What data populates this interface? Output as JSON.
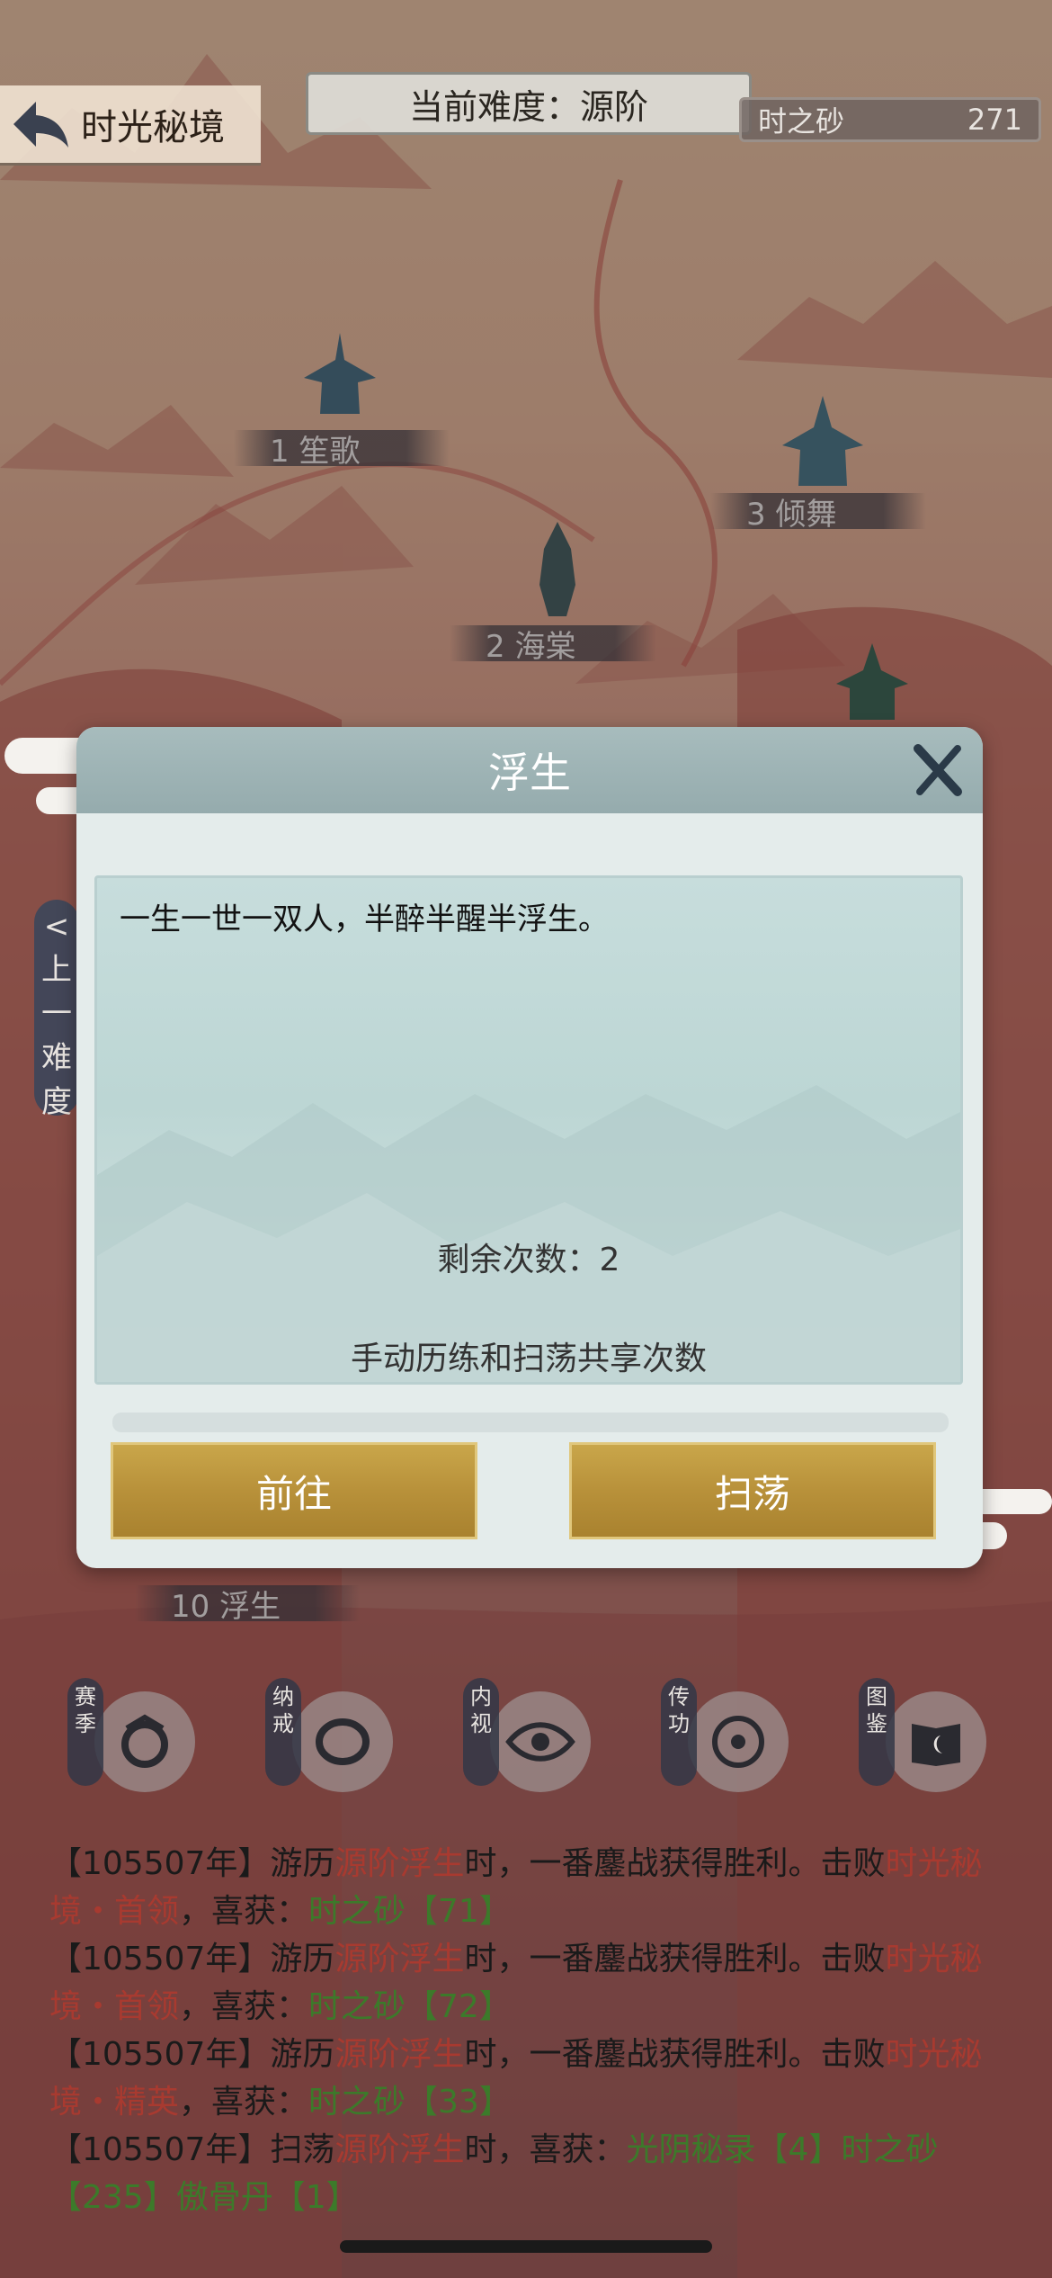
{
  "header": {
    "back_title": "时光秘境",
    "difficulty": "当前难度：源阶",
    "currency_name": "时之砂",
    "currency_value": "271"
  },
  "stages": [
    {
      "label": "1 笙歌"
    },
    {
      "label": "2 海棠"
    },
    {
      "label": "3 倾舞"
    },
    {
      "label": "10 浮生"
    }
  ],
  "side_tab": {
    "chars": [
      "<",
      "上",
      "一",
      "难",
      "度"
    ]
  },
  "modal": {
    "title": "浮生",
    "description": "一生一世一双人，半醉半醒半浮生。",
    "remaining": "剩余次数：2",
    "shared_note": "手动历练和扫荡共享次数",
    "go_label": "前往",
    "sweep_label": "扫荡"
  },
  "icons": [
    {
      "tag": [
        "赛",
        "季"
      ],
      "name": "season-icon"
    },
    {
      "tag": [
        "纳",
        "戒"
      ],
      "name": "ring-icon"
    },
    {
      "tag": [
        "内",
        "视"
      ],
      "name": "eye-icon"
    },
    {
      "tag": [
        "传",
        "功"
      ],
      "name": "transfer-icon"
    },
    {
      "tag": [
        "图",
        "鉴"
      ],
      "name": "book-icon"
    }
  ],
  "log": [
    [
      {
        "t": "【105507年】游历",
        "c": ""
      },
      {
        "t": "源阶浮生",
        "c": "r"
      },
      {
        "t": "时，一番鏖战获得胜利。击败",
        "c": ""
      },
      {
        "t": "时光秘境・首领",
        "c": "r"
      },
      {
        "t": "，喜获：",
        "c": ""
      },
      {
        "t": "时之砂【71】",
        "c": "g"
      }
    ],
    [
      {
        "t": "【105507年】游历",
        "c": ""
      },
      {
        "t": "源阶浮生",
        "c": "r"
      },
      {
        "t": "时，一番鏖战获得胜利。击败",
        "c": ""
      },
      {
        "t": "时光秘境・首领",
        "c": "r"
      },
      {
        "t": "，喜获：",
        "c": ""
      },
      {
        "t": "时之砂【72】",
        "c": "g"
      }
    ],
    [
      {
        "t": "【105507年】游历",
        "c": ""
      },
      {
        "t": "源阶浮生",
        "c": "r"
      },
      {
        "t": "时，一番鏖战获得胜利。击败",
        "c": ""
      },
      {
        "t": "时光秘境・精英",
        "c": "r"
      },
      {
        "t": "，喜获：",
        "c": ""
      },
      {
        "t": "时之砂【33】",
        "c": "g"
      }
    ],
    [
      {
        "t": "【105507年】扫荡",
        "c": ""
      },
      {
        "t": "源阶浮生",
        "c": "r"
      },
      {
        "t": "时，喜获：",
        "c": ""
      },
      {
        "t": "光阴秘录【4】时之砂【235】傲骨丹【1】",
        "c": "g"
      }
    ]
  ]
}
